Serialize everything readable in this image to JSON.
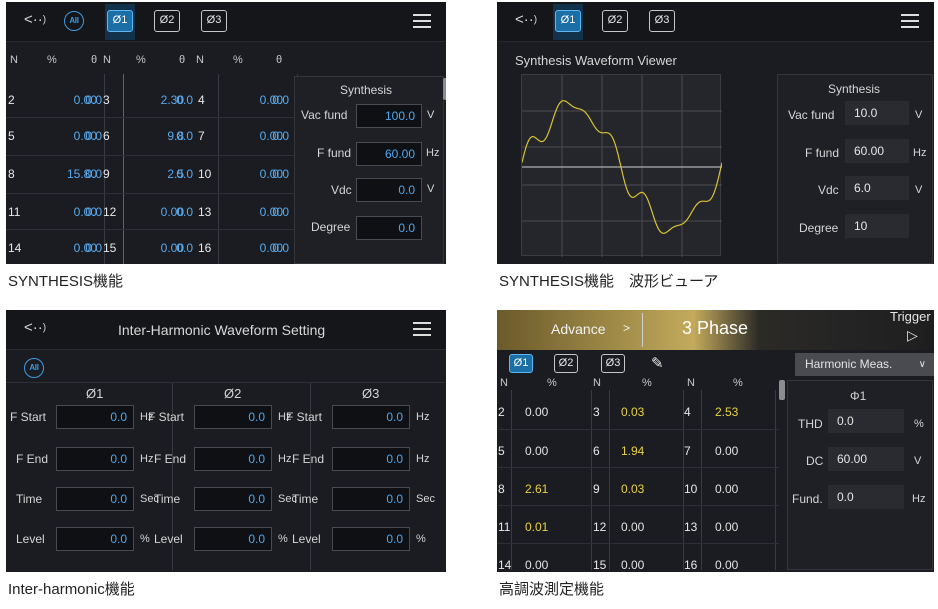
{
  "p1": {
    "header": {
      "all": "All",
      "ph1": "Ø1",
      "ph2": "Ø2",
      "ph3": "Ø3"
    },
    "cols": [
      "N",
      "%",
      "θ",
      "N",
      "%",
      "θ",
      "N",
      "%",
      "θ"
    ],
    "rows": [
      [
        "2",
        "0.00",
        "0.0",
        "3",
        "2.30",
        "0.0",
        "4",
        "0.00",
        "0.0"
      ],
      [
        "5",
        "0.00",
        "0.0",
        "6",
        "9.8",
        "0.0",
        "7",
        "0.00",
        "0.0"
      ],
      [
        "8",
        "15.80",
        "0.0",
        "9",
        "2.5",
        "0.0",
        "10",
        "0.00",
        "0.0"
      ],
      [
        "11",
        "0.00",
        "0.0",
        "12",
        "0.00",
        "0.0",
        "13",
        "0.00",
        "0.0"
      ],
      [
        "14",
        "0.00",
        "0.0",
        "15",
        "0.00",
        "0.0",
        "16",
        "0.00",
        "0.0"
      ]
    ],
    "synth": {
      "title": "Synthesis",
      "vac": "Vac fund",
      "vac_v": "100.0",
      "vac_u": "V",
      "ff": "F fund",
      "ff_v": "60.00",
      "ff_u": "Hz",
      "vdc": "Vdc",
      "vdc_v": "0.0",
      "vdc_u": "V",
      "deg": "Degree",
      "deg_v": "0.0"
    },
    "caption": "SYNTHESIS機能"
  },
  "p2": {
    "header": {
      "ph1": "Ø1",
      "ph2": "Ø2",
      "ph3": "Ø3"
    },
    "viewer_title": "Synthesis Waveform Viewer",
    "synth": {
      "title": "Synthesis",
      "vac": "Vac fund",
      "vac_v": "10.0",
      "vac_u": "V",
      "ff": "F fund",
      "ff_v": "60.00",
      "ff_u": "Hz",
      "vdc": "Vdc",
      "vdc_v": "6.0",
      "vdc_u": "V",
      "deg": "Degree",
      "deg_v": "10"
    },
    "caption": "SYNTHESIS機能　波形ビューア"
  },
  "p3": {
    "title": "Inter-Harmonic Waveform Setting",
    "all": "All",
    "phases": [
      "Ø1",
      "Ø2",
      "Ø3"
    ],
    "fields": [
      {
        "label": "F Start",
        "value": "0.0",
        "unit": "Hz"
      },
      {
        "label": "F End",
        "value": "0.0",
        "unit": "Hz"
      },
      {
        "label": "Time",
        "value": "0.0",
        "unit": "Sec"
      },
      {
        "label": "Level",
        "value": "0.0",
        "unit": "%"
      }
    ],
    "caption": "Inter-harmonic機能"
  },
  "p4": {
    "advance": "Advance",
    "arrow": ">",
    "phase_mode": "3 Phase",
    "trigger": "Trigger",
    "ph1": "Ø1",
    "ph2": "Ø2",
    "ph3": "Ø3",
    "dropdown": "Harmonic Meas.",
    "cols": [
      "N",
      "%",
      "N",
      "%",
      "N",
      "%"
    ],
    "rows": [
      [
        "2",
        "0.00",
        "3",
        "0.03",
        "4",
        "2.53"
      ],
      [
        "5",
        "0.00",
        "6",
        "1.94",
        "7",
        "0.00"
      ],
      [
        "8",
        "2.61",
        "9",
        "0.03",
        "10",
        "0.00"
      ],
      [
        "11",
        "0.01",
        "12",
        "0.00",
        "13",
        "0.00"
      ],
      [
        "14",
        "0.00",
        "15",
        "0.00",
        "16",
        "0.00"
      ]
    ],
    "meas": {
      "title": "Φ1",
      "thd": "THD",
      "thd_v": "0.0",
      "thd_u": "%",
      "dc": "DC",
      "dc_v": "60.00",
      "dc_u": "V",
      "fund": "Fund.",
      "fund_v": "0.0",
      "fund_u": "Hz"
    },
    "caption": "高調波測定機能"
  }
}
